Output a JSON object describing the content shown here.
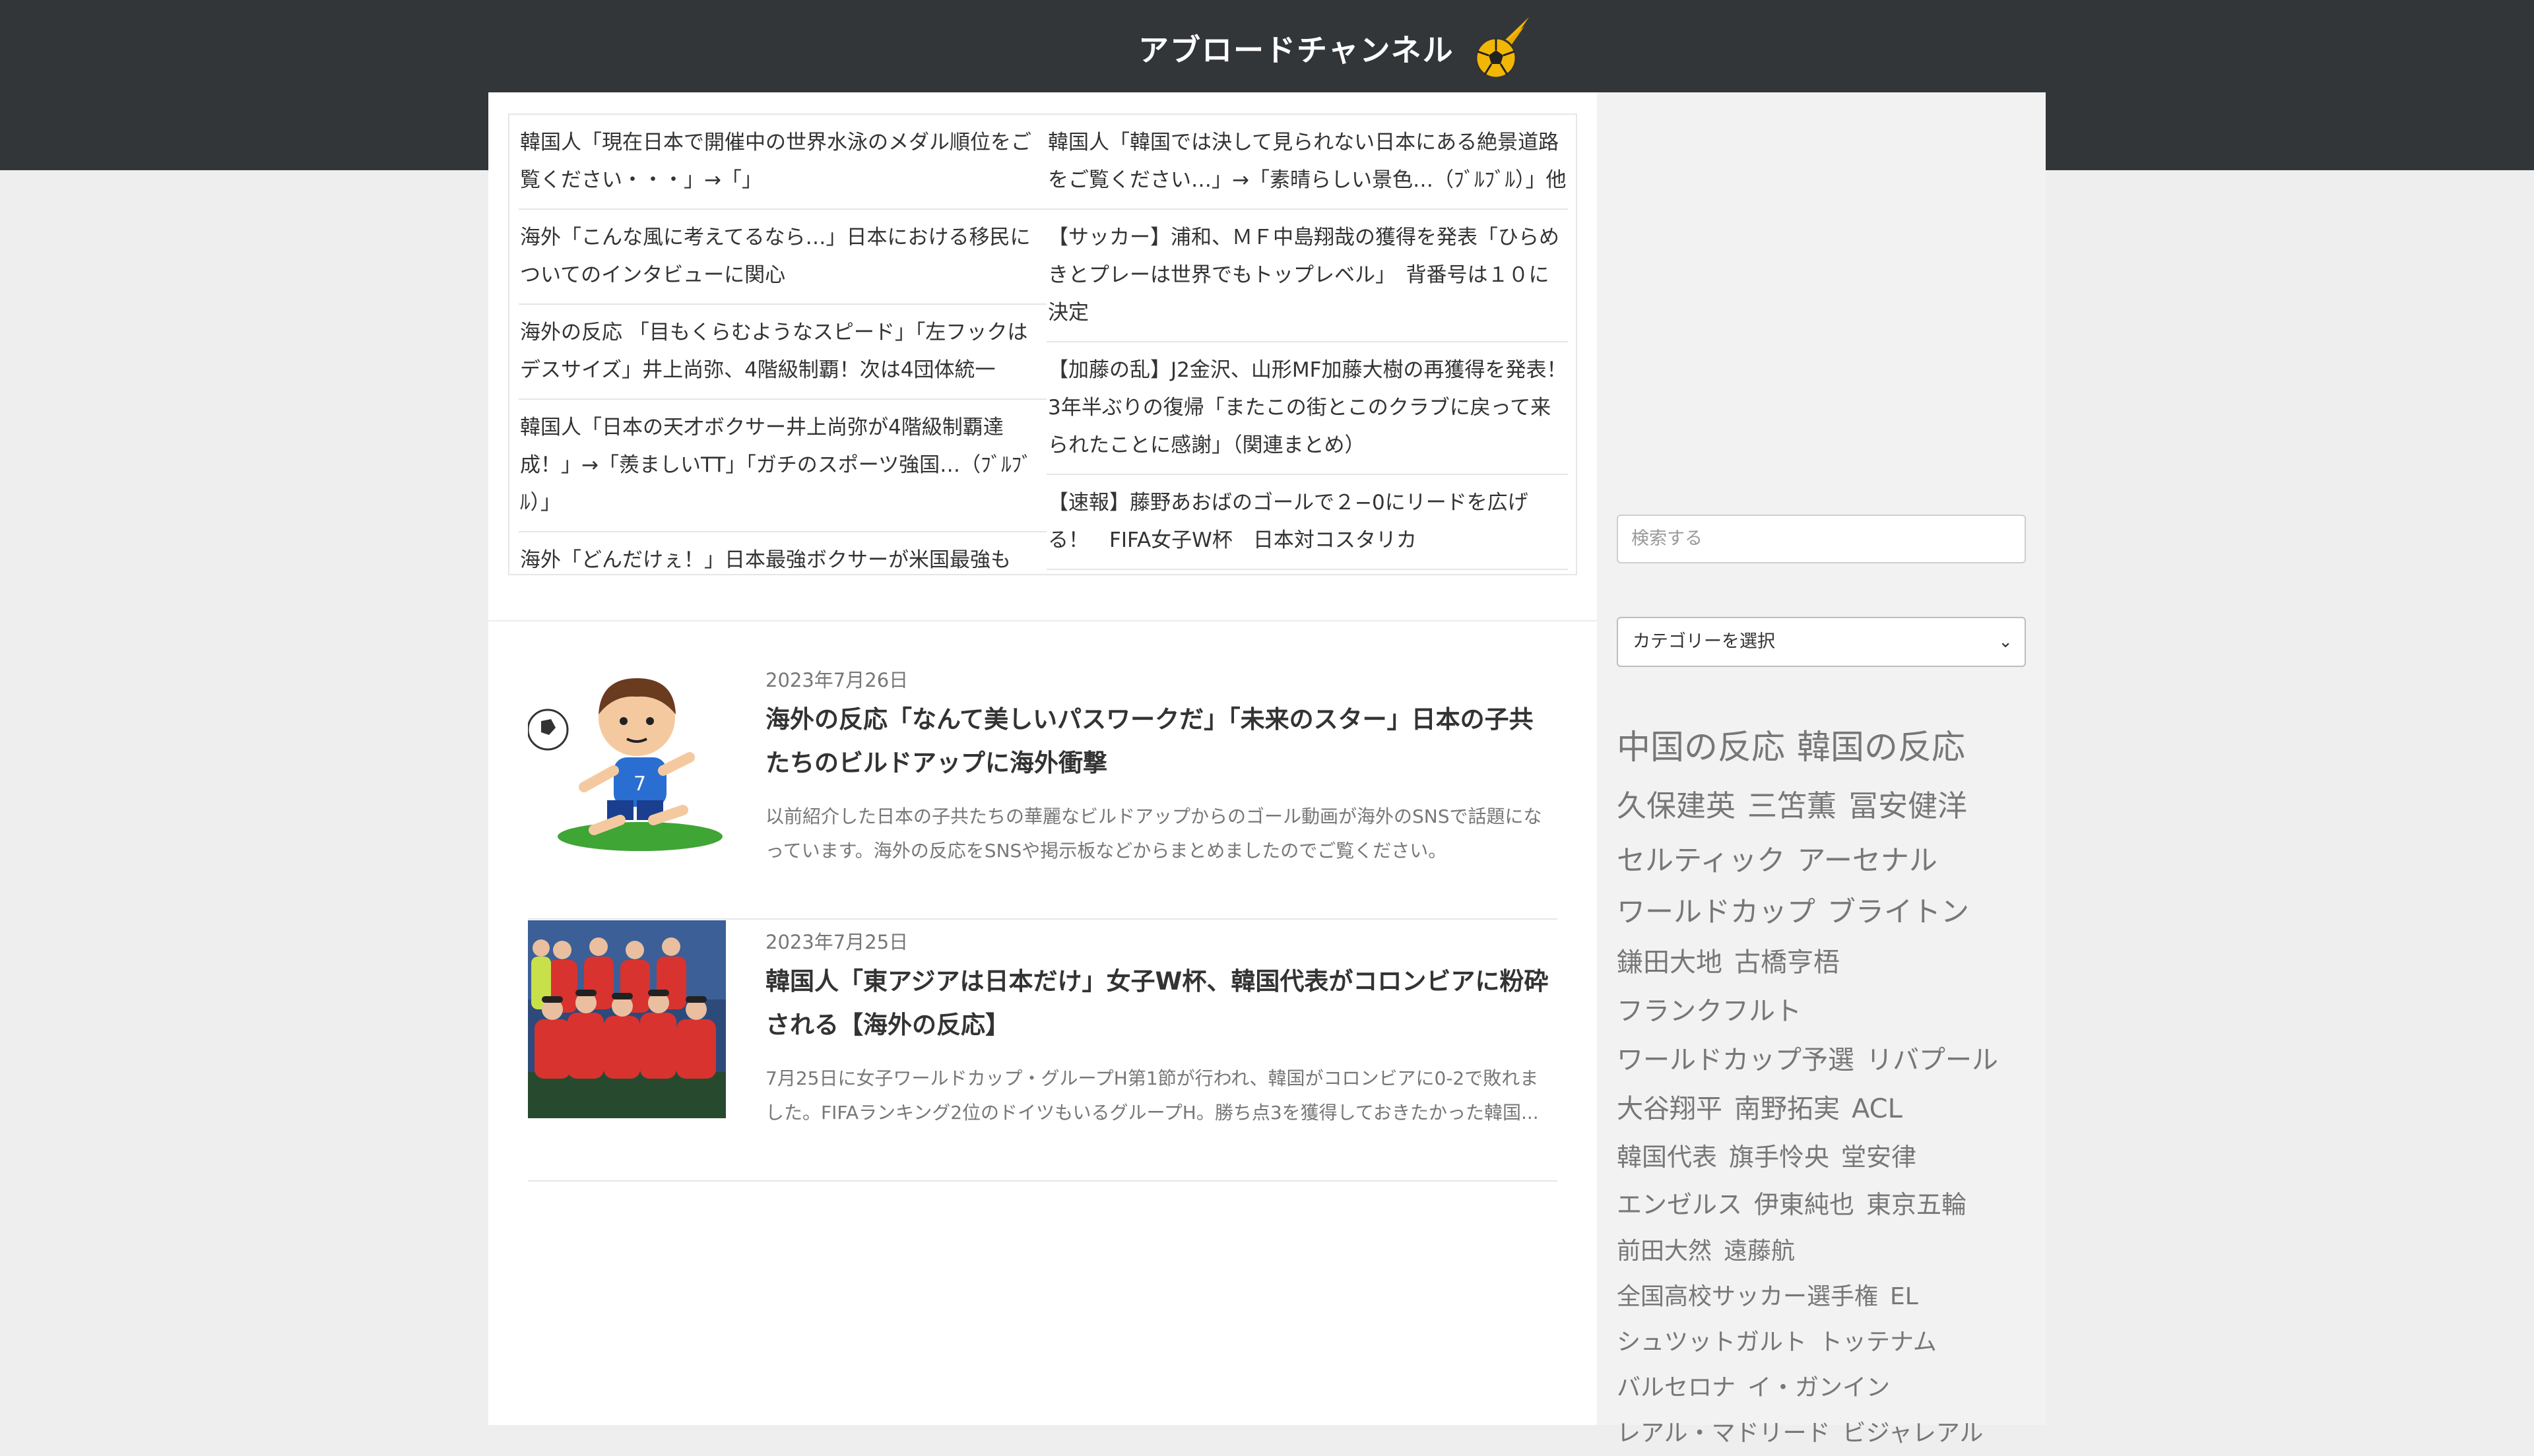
{
  "site": {
    "logo_text": "アブロードチャンネル"
  },
  "ticker": {
    "left": [
      "韓国人「現在日本で開催中の世界水泳のメダル順位をご覧ください・・・」→「」",
      "海外「こんな風に考えてるなら…」日本における移民についてのインタビューに関心",
      "海外の反応 「目もくらむようなスピード」「左フックはデスサイズ」井上尚弥、4階級制覇！次は4団体統一",
      "韓国人「日本の天才ボクサー井上尚弥が4階級制覇達成！」→「羨ましいTT」「ガチのスポーツ強国…（ﾌﾞﾙﾌﾞﾙ）」",
      "海外「どんだけぇ！」日本最強ボクサーが米国最強も"
    ],
    "right": [
      "韓国人「韓国では決して見られない日本にある絶景道路をご覧ください…」→「素晴らしい景色…（ﾌﾞﾙﾌﾞﾙ）」他",
      "【サッカー】浦和、ＭＦ中島翔哉の獲得を発表「ひらめきとプレーは世界でもトップレベル」　背番号は１０に決定",
      "【加藤の乱】J2金沢、山形MF加藤大樹の再獲得を発表！3年半ぶりの復帰「またこの街とこのクラブに戻って来られたことに感謝」（関連まとめ）",
      "【速報】藤野あおばのゴールで２−0にリードを広げる！　FIFA女子W杯　日本対コスタリカ"
    ]
  },
  "articles": [
    {
      "date": "2023年7月26日",
      "title": "海外の反応「なんて美しいパスワークだ」「未来のスター」日本の子共たちのビルドアップに海外衝撃",
      "excerpt": "以前紹介した日本の子共たちの華麗なビルドアップからのゴール動画が海外のSNSで話題になっています。海外の反応をSNSや掲示板などからまとめましたのでご覧ください。"
    },
    {
      "date": "2023年7月25日",
      "title": "韓国人「東アジアは日本だけ」女子W杯、韓国代表がコロンビアに粉砕される【海外の反応】",
      "excerpt": "7月25日に女子ワールドカップ・グループH第1節が行われ、韓国がコロンビアに0-2で敗れました。FIFAランキング2位のドイツもいるグループH。勝ち点3を獲得しておきたかった韓国..."
    }
  ],
  "sidebar": {
    "search_placeholder": "検索する",
    "category_select": "カテゴリーを選択",
    "tags": [
      [
        "中国の反応",
        "韓国の反応"
      ],
      [
        "久保建英",
        "三笘薫",
        "冨安健洋"
      ],
      [
        "セルティック",
        "アーセナル"
      ],
      [
        "ワールドカップ",
        "ブライトン"
      ],
      [
        "鎌田大地",
        "古橋亨梧"
      ],
      [
        "フランクフルト"
      ],
      [
        "ワールドカップ予選",
        "リバプール"
      ],
      [
        "大谷翔平",
        "南野拓実",
        "ACL"
      ],
      [
        "韓国代表",
        "旗手怜央",
        "堂安律"
      ],
      [
        "エンゼルス",
        "伊東純也",
        "東京五輪"
      ],
      [
        "前田大然",
        "遠藤航"
      ],
      [
        "全国高校サッカー選手権",
        "EL"
      ],
      [
        "シュツットガルト",
        "トッテナム"
      ],
      [
        "バルセロナ",
        "イ・ガンイン"
      ],
      [
        "レアル・マドリード",
        "ビジャレアル"
      ]
    ]
  },
  "colors": {
    "header_band": "#333639",
    "logo_accent": "#f2b705",
    "body_bg": "#eeeeee"
  }
}
